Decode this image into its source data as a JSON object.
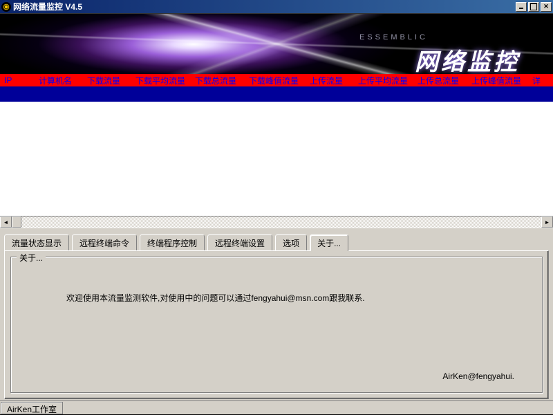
{
  "title": "网络流量监控  V4.5",
  "window_buttons": {
    "min": "minimize",
    "max": "maximize",
    "close": "close"
  },
  "banner": {
    "smalltext": "ESSEMBLIC",
    "bigtext": "网络监控"
  },
  "columns": [
    "IP",
    "计算机名",
    "下载流量",
    "下载平均流量",
    "下载总流量",
    "下载峰值流量",
    "上传流量",
    "上传平均流量",
    "上传总流量",
    "上传峰值流量",
    "详"
  ],
  "tabs": [
    {
      "label": "流量状态显示"
    },
    {
      "label": "远程终端命令"
    },
    {
      "label": "终端程序控制"
    },
    {
      "label": "远程终端设置"
    },
    {
      "label": "选项"
    },
    {
      "label": "关于...",
      "active": true
    }
  ],
  "about": {
    "group_title": "关于...",
    "message": "欢迎使用本流量监测软件,对使用中的问题可以通过fengyahui@msn.com跟我联系.",
    "signature": "AirKen@fengyahui."
  },
  "statusbar": {
    "cell1": "AirKen工作室"
  }
}
